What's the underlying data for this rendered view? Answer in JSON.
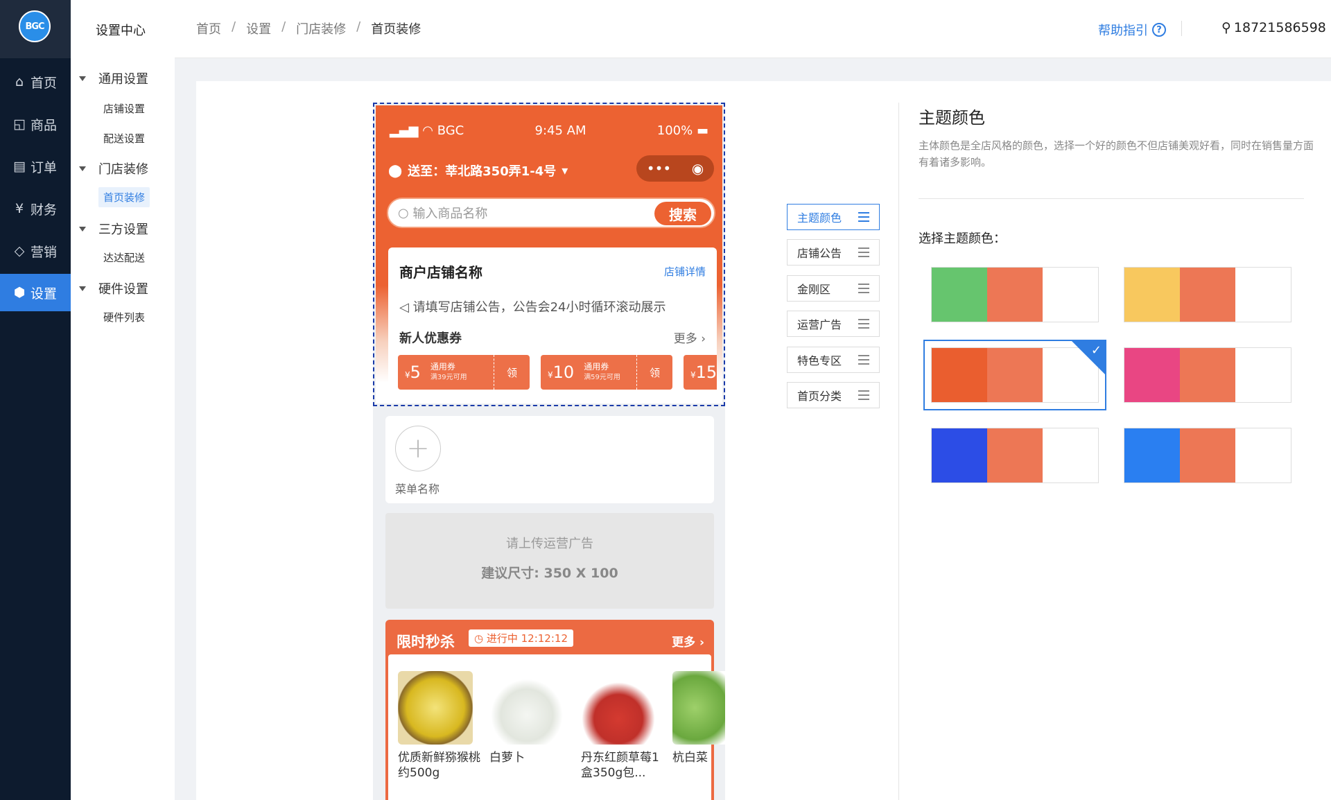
{
  "sidebar": {
    "logo": "BGC",
    "items": [
      {
        "label": "首页",
        "icon": "home-icon"
      },
      {
        "label": "商品",
        "icon": "bag-icon"
      },
      {
        "label": "订单",
        "icon": "order-icon"
      },
      {
        "label": "财务",
        "icon": "yen-icon"
      },
      {
        "label": "营销",
        "icon": "tag-icon"
      },
      {
        "label": "设置",
        "icon": "settings-icon",
        "active": true
      }
    ]
  },
  "subnav": {
    "title": "设置中心",
    "groups": [
      {
        "label": "通用设置",
        "children": [
          "店铺设置",
          "配送设置"
        ]
      },
      {
        "label": "门店装修",
        "children": [
          "首页装修"
        ]
      },
      {
        "label": "三方设置",
        "children": [
          "达达配送"
        ]
      },
      {
        "label": "硬件设置",
        "children": [
          "硬件列表"
        ]
      }
    ],
    "active": "首页装修"
  },
  "topbar": {
    "breadcrumbs": [
      "首页",
      "设置",
      "门店装修",
      "首页装修"
    ],
    "separator": "/",
    "help": "帮助指引",
    "help_icon": "?",
    "user": "18721586598"
  },
  "phone": {
    "status": {
      "carrier": "BGC",
      "time": "9:45 AM",
      "battery": "100%"
    },
    "address": "送至：莘北路350弄1-4号",
    "search_placeholder": "输入商品名称",
    "search_button": "搜索",
    "store_name": "商户店铺名称",
    "store_detail": "店铺详情",
    "notice": "请填写店铺公告，公告会24小时循环滚动展示",
    "coupon_title": "新人优惠券",
    "more": "更多",
    "coupons": [
      {
        "currency": "¥",
        "amount": "5",
        "type": "通用券",
        "cond": "满39元可用",
        "get": "领"
      },
      {
        "currency": "¥",
        "amount": "10",
        "type": "通用券",
        "cond": "满59元可用",
        "get": "领"
      },
      {
        "currency": "¥",
        "amount": "15",
        "type": "",
        "cond": "",
        "get": ""
      }
    ],
    "menu_label": "菜单名称",
    "ad_line1": "请上传运营广告",
    "ad_line2": "建议尺寸: 350 X 100",
    "flash_title": "限时秒杀",
    "flash_timer": "进行中 12:12:12",
    "flash_more": "更多",
    "products": [
      {
        "name": "优质新鲜猕猴桃约500g",
        "color": "#d8b820"
      },
      {
        "name": "白萝卜",
        "color": "#e8ece6"
      },
      {
        "name": "丹东红颜草莓1盒350g包...",
        "color": "#d43a30"
      },
      {
        "name": "杭白菜",
        "color": "#7ab848"
      }
    ]
  },
  "modules": [
    "主题颜色",
    "店铺公告",
    "金刚区",
    "运营广告",
    "特色专区",
    "首页分类"
  ],
  "active_module": "主题颜色",
  "theme": {
    "title": "主题颜色",
    "description": "主体颜色是全店风格的颜色，选择一个好的颜色不但店铺美观好看，同时在销售量方面有着诸多影响。",
    "choose_label": "选择主题颜色：",
    "swatches": [
      {
        "primary": "#66c56e",
        "secondary": "#ed7755",
        "selected": false
      },
      {
        "primary": "#f8c85e",
        "secondary": "#ed7755",
        "selected": false
      },
      {
        "primary": "#ea5e2f",
        "secondary": "#ed7755",
        "selected": true
      },
      {
        "primary": "#e94683",
        "secondary": "#ed7755",
        "selected": false
      },
      {
        "primary": "#2c4de6",
        "secondary": "#ed7755",
        "selected": false
      },
      {
        "primary": "#2a7ff1",
        "secondary": "#ed7755",
        "selected": false
      }
    ]
  }
}
